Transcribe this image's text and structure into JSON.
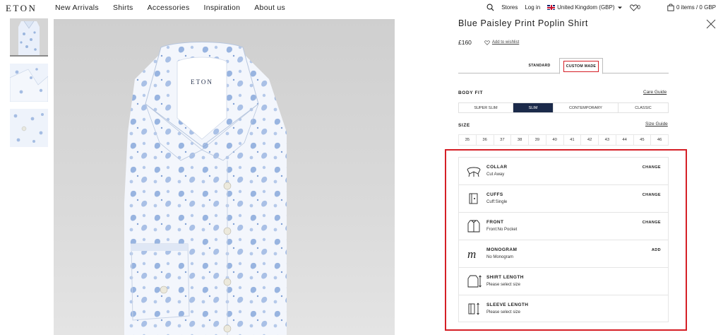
{
  "header": {
    "logo": "ETON",
    "nav": [
      "New Arrivals",
      "Shirts",
      "Accessories",
      "Inspiration",
      "About us"
    ],
    "stores": "Stores",
    "login": "Log in",
    "region": "United Kingdom (GBP)",
    "wishlist_count": "0",
    "cart": "0 items / 0 GBP"
  },
  "product": {
    "title": "Blue Paisley Print Poplin Shirt",
    "price": "£160",
    "wishlist_link": "Add to wishlist",
    "shirt_label": "ETON"
  },
  "tabs": {
    "standard": "STANDARD",
    "custom": "CUSTOM MADE",
    "active": "CUSTOM MADE"
  },
  "body_fit": {
    "label": "BODY FIT",
    "guide": "Care Guide",
    "options": [
      "SUPER SLIM",
      "SLIM",
      "CONTEMPORARY",
      "CLASSIC"
    ],
    "selected": "SLIM"
  },
  "size": {
    "label": "SIZE",
    "guide": "Size Guide",
    "options": [
      "35",
      "36",
      "37",
      "38",
      "39",
      "40",
      "41",
      "42",
      "43",
      "44",
      "45",
      "46"
    ]
  },
  "customizations": [
    {
      "name": "COLLAR",
      "value": "Cut Away",
      "action": "CHANGE",
      "icon": "collar-icon"
    },
    {
      "name": "CUFFS",
      "value": "Cuff:Single",
      "action": "CHANGE",
      "icon": "cuff-icon"
    },
    {
      "name": "FRONT",
      "value": "Front:No Pocket",
      "action": "CHANGE",
      "icon": "shirt-front-icon"
    },
    {
      "name": "MONOGRAM",
      "value": "No Monogram",
      "action": "ADD",
      "icon": "monogram-icon"
    },
    {
      "name": "SHIRT LENGTH",
      "value": "Please select size",
      "action": "",
      "icon": "shirt-length-icon"
    },
    {
      "name": "SLEEVE LENGTH",
      "value": "Please select size",
      "action": "",
      "icon": "sleeve-length-icon"
    }
  ],
  "colors": {
    "accent": "#1b2a4a",
    "highlight": "#d51f26",
    "shirt_blue": "#8fb0dc"
  }
}
